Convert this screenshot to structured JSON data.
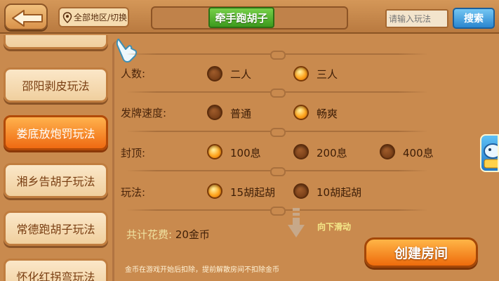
{
  "header": {
    "region_label": "全部地区/切换",
    "title": "牵手跑胡子",
    "search_placeholder": "请输入玩法",
    "search_button": "搜索"
  },
  "sidebar": {
    "items": [
      {
        "label": "邵阳剥皮玩法",
        "active": false
      },
      {
        "label": "娄底放炮罚玩法",
        "active": true
      },
      {
        "label": "湘乡告胡子玩法",
        "active": false
      },
      {
        "label": "常德跑胡子玩法",
        "active": false
      },
      {
        "label": "怀化红拐弯玩法",
        "active": false
      }
    ]
  },
  "settings": {
    "players": {
      "label": "人数:",
      "options": [
        "二人",
        "三人"
      ],
      "selected": 1
    },
    "deal_speed": {
      "label": "发牌速度:",
      "options": [
        "普通",
        "畅爽"
      ],
      "selected": 1
    },
    "cap": {
      "label": "封顶:",
      "options": [
        "100息",
        "200息",
        "400息"
      ],
      "selected": 0
    },
    "rule": {
      "label": "玩法:",
      "options": [
        "15胡起胡",
        "10胡起胡"
      ],
      "selected": 0
    }
  },
  "footer": {
    "cost_label": "共计花费:",
    "cost_value": "20金币",
    "scroll_hint": "向下滑动",
    "create_button": "创建房间",
    "note": "金币在游戏开始后扣除，提前解散房间不扣除金币"
  },
  "colors": {
    "accent_orange": "#ef6a12",
    "title_green": "#3c9a1d",
    "search_blue": "#2a86cf",
    "panel_bg": "#c98a4e"
  }
}
